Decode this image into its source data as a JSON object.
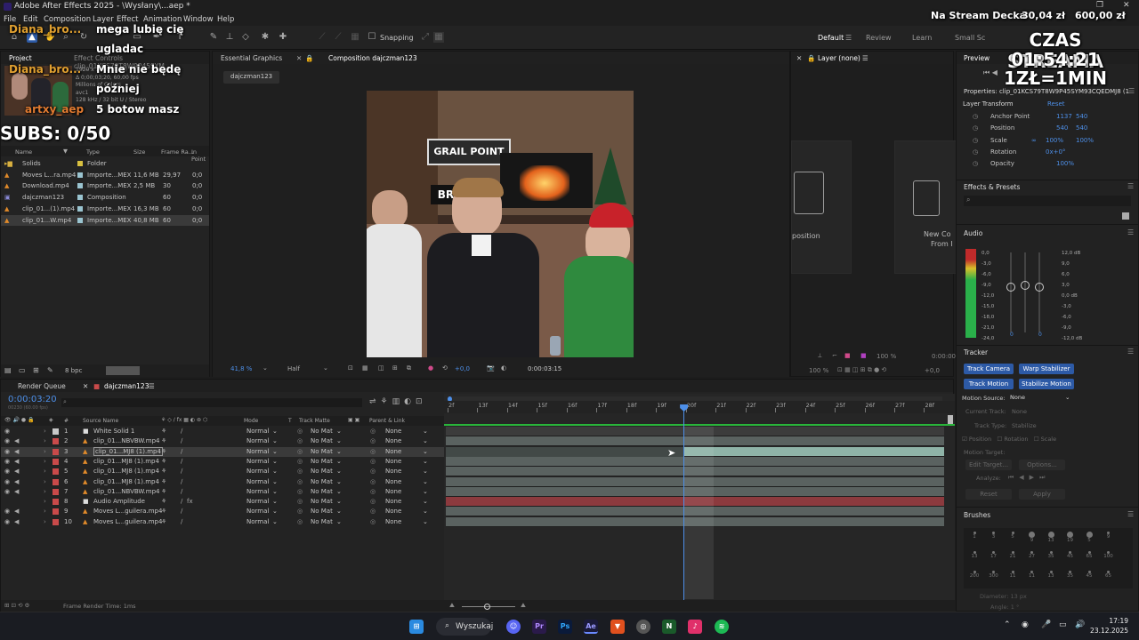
{
  "app": {
    "title": "Adobe After Effects 2025 - \\Wysłany\\...aep *",
    "menu": [
      "File",
      "Edit",
      "Composition",
      "Layer",
      "Effect",
      "Animation",
      "Window",
      "Help"
    ]
  },
  "toolbar": {
    "snapping_label": "Snapping",
    "workspaces": [
      "Default",
      "Review",
      "Learn",
      "Small Sc"
    ]
  },
  "stream_overlay": {
    "ticker_title": "Na Stream Decka",
    "ticker_price": "30,04 zł",
    "ticker_goal": "600,00 zł",
    "timer_title": "CZAS STREAMA",
    "timer_value": "01:54:21",
    "rate": "1ZŁ=1MIN",
    "subs": "SUBS: 0/50",
    "chat": [
      {
        "user": "Diana_bro...",
        "msg": "mega lubię cię"
      },
      {
        "user": "",
        "msg": "ugladac"
      },
      {
        "user": "Diana_bro...",
        "msg": "Mnie nie będę"
      },
      {
        "user": "",
        "msg": "później"
      },
      {
        "user": "artxy_aep",
        "msg": "5 botow masz"
      }
    ]
  },
  "project_panel": {
    "tab_project": "Project",
    "tab_effects": "Effect Controls clip_01KCS79T8W9P45SYM",
    "info_lines": [
      "1920 x 1080 (1,00)",
      "Δ 0;00;03;20, 60,00 fps",
      "Millions of Colors",
      "avc1",
      "128 kHz / 32 bit U / Stereo"
    ],
    "columns": [
      "Name",
      "Type",
      "Size",
      "Frame Ra...",
      "In Point"
    ],
    "items": [
      {
        "name": "Solids",
        "type": "Folder",
        "size": "",
        "fps": "",
        "in": "",
        "icon": "folder"
      },
      {
        "name": "Moves L...ra.mp4",
        "type": "Importe...MEX",
        "size": "11,6 MB",
        "fps": "29,97",
        "in": "0;0",
        "icon": "footage"
      },
      {
        "name": "Download.mp4",
        "type": "Importe...MEX",
        "size": "2,5 MB",
        "fps": "30",
        "in": "0;0",
        "icon": "footage"
      },
      {
        "name": "dajczman123",
        "type": "Composition",
        "size": "",
        "fps": "60",
        "in": "0;0",
        "icon": "comp"
      },
      {
        "name": "clip_01...(1).mp4",
        "type": "Importe...MEX",
        "size": "16,3 MB",
        "fps": "60",
        "in": "0;0",
        "icon": "footage"
      },
      {
        "name": "clip_01...W.mp4",
        "type": "Importe...MEX",
        "size": "40,8 MB",
        "fps": "60",
        "in": "0;0",
        "icon": "footage"
      }
    ],
    "bpc": "8 bpc"
  },
  "comp_viewer": {
    "tab_essential": "Essential Graphics",
    "tab_comp": "Composition dajczman123",
    "comp_name": "dajczman123",
    "zoom": "41,8 %",
    "resolution": "Half",
    "exposure": "+0,0",
    "timecode": "0:00:03:15",
    "scene_sign": "GRAIL POINT",
    "scene_sign2": "BRO"
  },
  "layer_panel": {
    "title": "Layer (none)",
    "card1": "position",
    "card2_line1": "New Co",
    "card2_line2": "From I",
    "zoom": "100 %",
    "time": "0:00:00"
  },
  "properties": {
    "tab_preview": "Preview",
    "title": "Properties: clip_01KCS79T8W9P45SYM93CQEDMJ8 (1",
    "section": "Layer Transform",
    "reset": "Reset",
    "rows": [
      {
        "label": "Anchor Point",
        "v1": "1137",
        "v2": "540"
      },
      {
        "label": "Position",
        "v1": "540",
        "v2": "540"
      },
      {
        "label": "Scale",
        "v1": "100%",
        "v2": "100%"
      },
      {
        "label": "Rotation",
        "v1": "0x+0°",
        "v2": ""
      },
      {
        "label": "Opacity",
        "v1": "100%",
        "v2": ""
      }
    ],
    "effects_title": "Effects & Presets",
    "audio_title": "Audio",
    "audio_left_scale": [
      "0,0",
      "-3,0",
      "-6,0",
      "-9,0",
      "-12,0",
      "-15,0",
      "-18,0",
      "-21,0",
      "-24,0"
    ],
    "audio_right_scale": [
      "12,0 dB",
      "9,0",
      "6,0",
      "3,0",
      "0,0 dB",
      "-3,0",
      "-6,0",
      "-9,0",
      "-12,0 dB"
    ],
    "audio_zero_l": "0",
    "audio_zero_r": "0",
    "tracker_title": "Tracker",
    "tracker_buttons": [
      "Track Camera",
      "Warp Stabilizer",
      "Track Motion",
      "Stabilize Motion"
    ],
    "motion_source_label": "Motion Source:",
    "motion_source_value": "None",
    "current_track_label": "Current Track:",
    "current_track_value": "None",
    "track_type_label": "Track Type:",
    "track_type_value": "Stabilize",
    "options": [
      "Position",
      "Rotation",
      "Scale"
    ],
    "motion_target": "Motion Target:",
    "edit_target": "Edit Target...",
    "options_btn": "Options...",
    "analyze": "Analyze:",
    "reset_btn": "Reset",
    "apply_btn": "Apply",
    "brushes_title": "Brushes",
    "brush_sizes": [
      "1",
      "3",
      "5",
      "9",
      "13",
      "19",
      "5",
      "9",
      "13",
      "17",
      "21",
      "27",
      "35",
      "45",
      "65",
      "100",
      "200",
      "300",
      "11",
      "11",
      "13",
      "35",
      "45",
      "65"
    ],
    "diameter": "Diameter: 13 px",
    "angle": "Angle: 1 °"
  },
  "timeline": {
    "tab_render": "Render Queue",
    "tab_comp": "dajczman123",
    "timecode": "0:00:03:20",
    "frame_sub": "00230 (60.00 fps)",
    "col_source": "Source Name",
    "col_mode": "Mode",
    "col_t": "T",
    "col_matte": "Track Matte",
    "col_parent": "Parent & Link",
    "ruler": [
      "2f",
      "13f",
      "14f",
      "15f",
      "16f",
      "17f",
      "18f",
      "19f",
      "20f",
      "21f",
      "22f",
      "23f",
      "24f",
      "25f",
      "26f",
      "27f",
      "28f"
    ],
    "layers": [
      {
        "num": "1",
        "name": "White Solid 1",
        "color": "#c8c8c8",
        "mode": "Normal",
        "matte": "No Mat",
        "parent": "None",
        "bar_start": 0,
        "bar_end": 1,
        "bar_color": "#3c3c3c",
        "selected": false
      },
      {
        "num": "2",
        "name": "clip_01...NBVBW.mp4",
        "color": "#c94a4a",
        "mode": "Normal",
        "matte": "No Mat",
        "parent": "None",
        "bar_start": 0,
        "bar_end": 1,
        "bar_color": "#5a6260",
        "selected": false
      },
      {
        "num": "3",
        "name": "clip_01...MJ8 (1).mp4",
        "color": "#c94a4a",
        "mode": "Normal",
        "matte": "No Mat",
        "parent": "None",
        "bar_start": 0.477,
        "bar_end": 1,
        "bar_color": "#8fb4a8",
        "selected": true
      },
      {
        "num": "4",
        "name": "clip_01...MJ8 (1).mp4",
        "color": "#c94a4a",
        "mode": "Normal",
        "matte": "No Mat",
        "parent": "None",
        "bar_start": 0,
        "bar_end": 1,
        "bar_color": "#5a6260",
        "selected": false
      },
      {
        "num": "5",
        "name": "clip_01...MJ8 (1).mp4",
        "color": "#c94a4a",
        "mode": "Normal",
        "matte": "No Mat",
        "parent": "None",
        "bar_start": 0,
        "bar_end": 1,
        "bar_color": "#5a6260",
        "selected": false
      },
      {
        "num": "6",
        "name": "clip_01...MJ8 (1).mp4",
        "color": "#c94a4a",
        "mode": "Normal",
        "matte": "No Mat",
        "parent": "None",
        "bar_start": 0,
        "bar_end": 1,
        "bar_color": "#5a6260",
        "selected": false
      },
      {
        "num": "7",
        "name": "clip_01...NBVBW.mp4",
        "color": "#c94a4a",
        "mode": "Normal",
        "matte": "No Mat",
        "parent": "None",
        "bar_start": 0,
        "bar_end": 1,
        "bar_color": "#5a6260",
        "selected": false
      },
      {
        "num": "8",
        "name": "Audio Amplitude",
        "color": "#c94a4a",
        "mode": "Normal",
        "matte": "No Mat",
        "parent": "None",
        "bar_start": 0,
        "bar_end": 1,
        "bar_color": "#8c3a3e",
        "selected": false
      },
      {
        "num": "9",
        "name": "Moves L...guilera.mp4",
        "color": "#c94a4a",
        "mode": "Normal",
        "matte": "No Mat",
        "parent": "None",
        "bar_start": 0,
        "bar_end": 1,
        "bar_color": "#5a6260",
        "selected": false
      },
      {
        "num": "10",
        "name": "Moves L...guilera.mp4",
        "color": "#c94a4a",
        "mode": "Normal",
        "matte": "No Mat",
        "parent": "None",
        "bar_start": 0,
        "bar_end": 1,
        "bar_color": "#5a6260",
        "selected": false
      }
    ],
    "playhead_fraction": 0.477,
    "render_time": "Frame Render Time:  1ms"
  },
  "taskbar": {
    "search": "Wyszukaj",
    "time": "17:19",
    "date": "23.12.2025",
    "apps": [
      "discord",
      "premiere",
      "photoshop",
      "after-effects",
      "brave",
      "chrome",
      "nvidia",
      "tiktok",
      "spotify"
    ]
  }
}
